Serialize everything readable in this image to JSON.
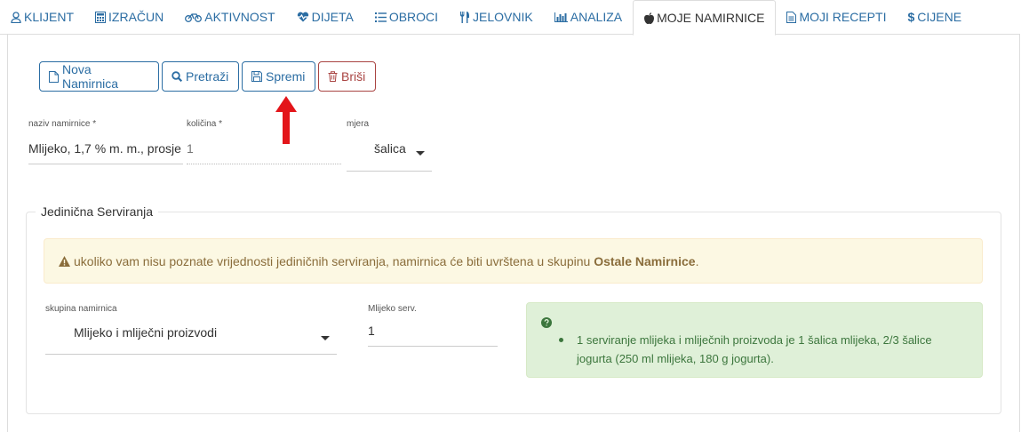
{
  "tabs": [
    {
      "label": "KLIJENT",
      "icon": "user-icon"
    },
    {
      "label": "IZRAČUN",
      "icon": "calculator-icon"
    },
    {
      "label": "AKTIVNOST",
      "icon": "bicycle-icon"
    },
    {
      "label": "DIJETA",
      "icon": "heartbeat-icon"
    },
    {
      "label": "OBROCI",
      "icon": "list-icon"
    },
    {
      "label": "JELOVNIK",
      "icon": "cutlery-icon"
    },
    {
      "label": "ANALIZA",
      "icon": "bar-chart-icon"
    },
    {
      "label": "MOJE NAMIRNICE",
      "icon": "apple-icon",
      "active": true
    },
    {
      "label": "MOJI RECEPTI",
      "icon": "file-text-icon"
    },
    {
      "label": "CIJENE",
      "icon": "dollar-icon"
    }
  ],
  "toolbar": {
    "new_label": "Nova Namirnica",
    "search_label": "Pretraži",
    "save_label": "Spremi",
    "delete_label": "Briši"
  },
  "form": {
    "name_label": "naziv namirnice *",
    "name_value": "Mlijeko, 1,7 % m. m., prosje",
    "qty_label": "količina *",
    "qty_placeholder": "1",
    "unit_label": "mjera",
    "unit_value": "šalica"
  },
  "serving": {
    "legend": "Jedinična Serviranja",
    "warning_text": "ukoliko vam nisu poznate vrijednosti jediničnih serviranja, namirnica će biti uvrštena u skupinu",
    "warning_bold": "Ostale Namirnice",
    "warning_end": ".",
    "group_label": "skupina namirnica",
    "group_value": "Mlijeko i mliječni proizvodi",
    "serv_label": "Mlijeko serv.",
    "serv_value": "1",
    "info_text": "1 serviranje mlijeka i mliječnih proizvoda je 1 šalica mlijeka, 2/3 šalice jogurta (250 ml mlijeka, 180 g jogurta)."
  },
  "colors": {
    "link": "#2b6da3",
    "danger": "#a94442",
    "warning_bg": "#fcf8e3",
    "success_bg": "#dff0d8",
    "annotation_arrow": "#e3151a"
  }
}
